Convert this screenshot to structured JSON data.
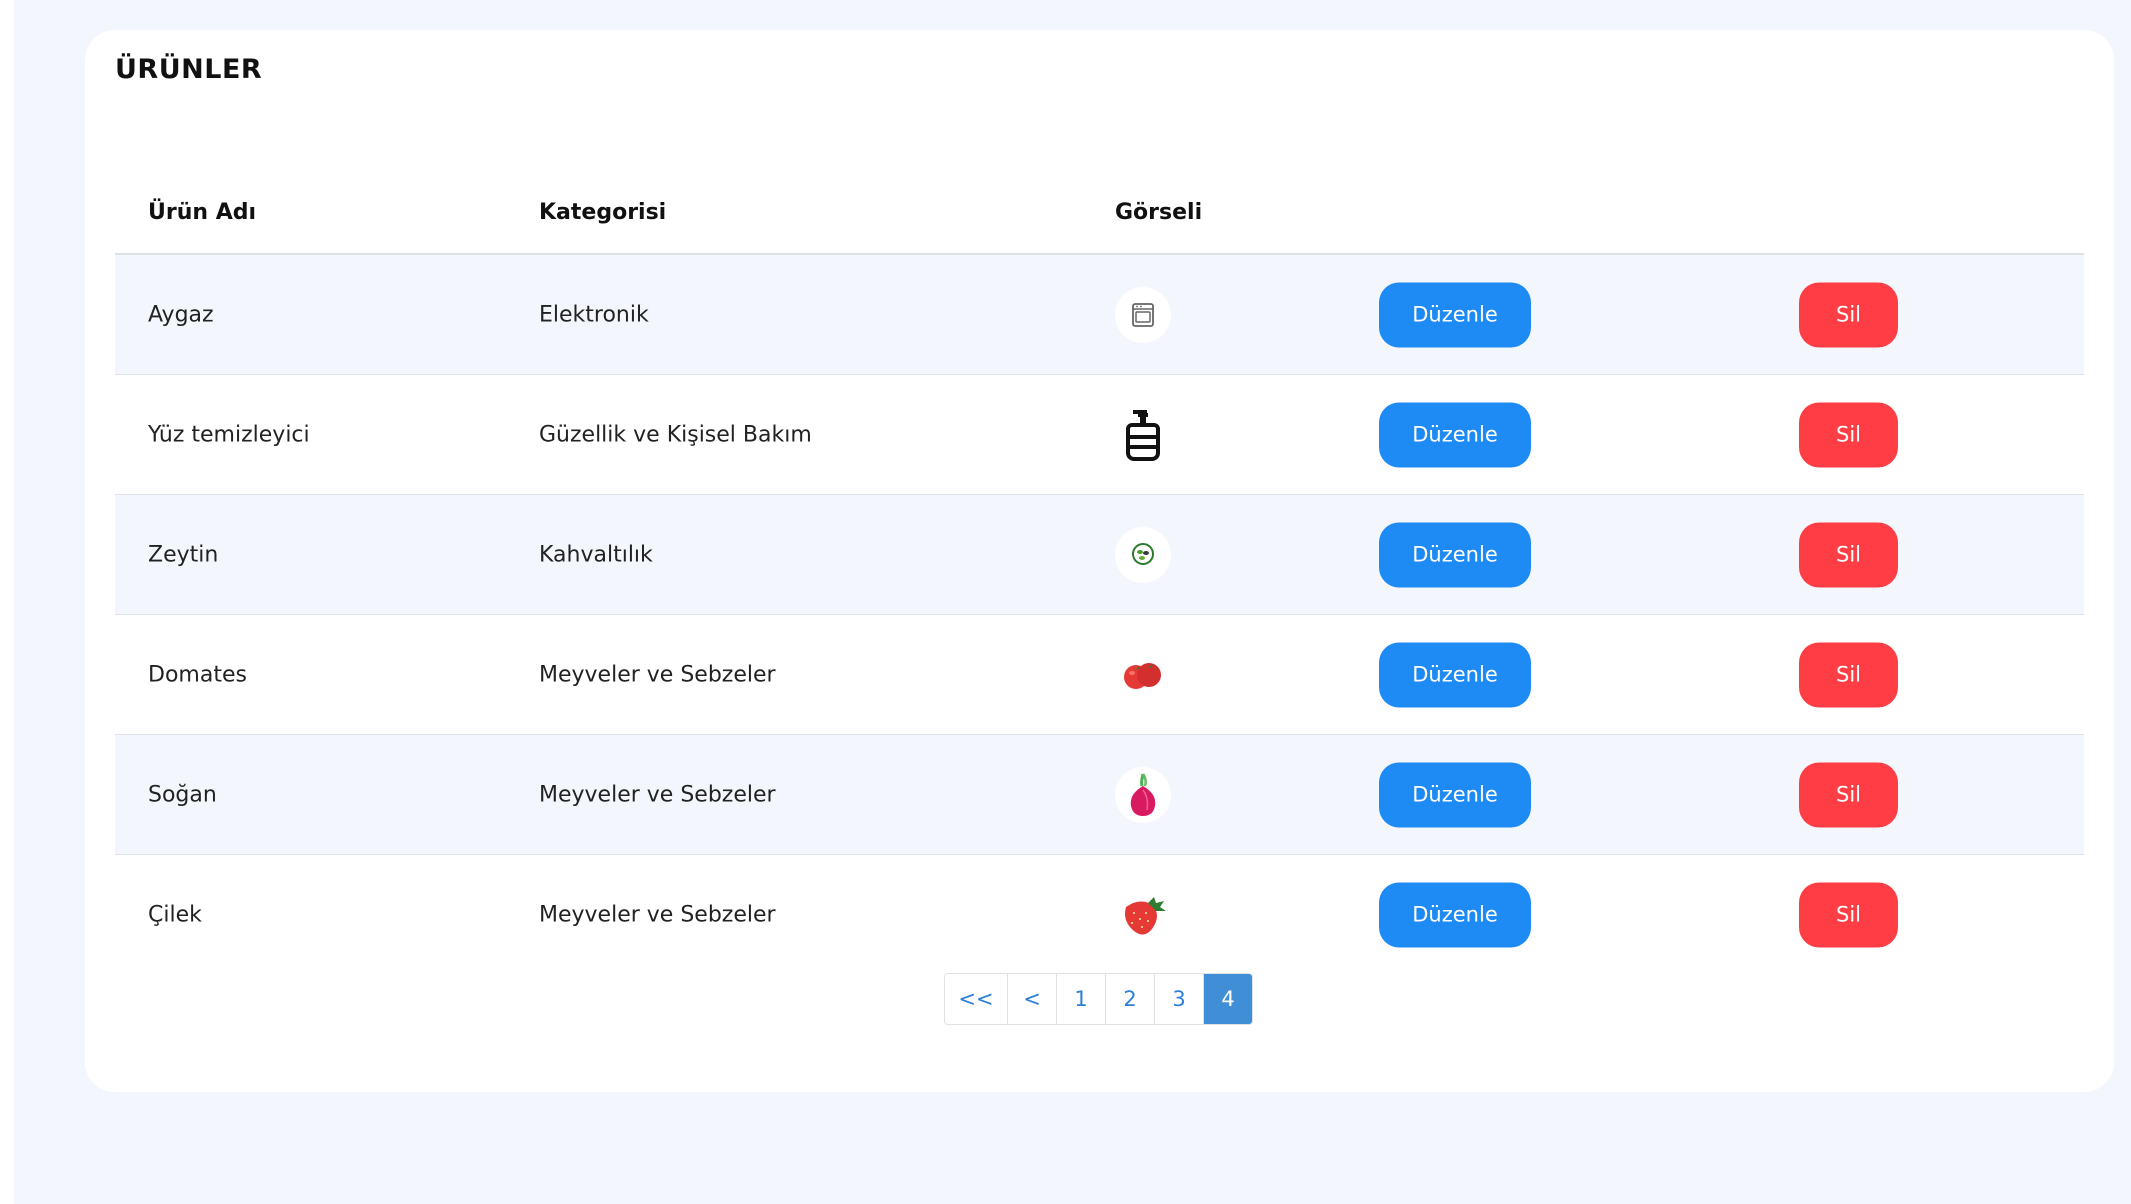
{
  "page": {
    "title": "ÜRÜNLER"
  },
  "table": {
    "headers": {
      "name": "Ürün Adı",
      "category": "Kategorisi",
      "image": "Görseli"
    },
    "rows": [
      {
        "name": "Aygaz",
        "category": "Elektronik",
        "icon": "oven-icon",
        "edit_label": "Düzenle",
        "delete_label": "Sil"
      },
      {
        "name": "Yüz temizleyici",
        "category": "Güzellik ve Kişisel Bakım",
        "icon": "soap-dispenser-icon",
        "edit_label": "Düzenle",
        "delete_label": "Sil"
      },
      {
        "name": "Zeytin",
        "category": "Kahvaltılık",
        "icon": "olive-icon",
        "edit_label": "Düzenle",
        "delete_label": "Sil"
      },
      {
        "name": "Domates",
        "category": "Meyveler ve Sebzeler",
        "icon": "tomato-icon",
        "edit_label": "Düzenle",
        "delete_label": "Sil"
      },
      {
        "name": "Soğan",
        "category": "Meyveler ve Sebzeler",
        "icon": "onion-icon",
        "edit_label": "Düzenle",
        "delete_label": "Sil"
      },
      {
        "name": "Çilek",
        "category": "Meyveler ve Sebzeler",
        "icon": "strawberry-icon",
        "edit_label": "Düzenle",
        "delete_label": "Sil"
      }
    ]
  },
  "pagination": {
    "first": "<<",
    "prev": "<",
    "pages": [
      "1",
      "2",
      "3",
      "4"
    ],
    "current": "4"
  },
  "colors": {
    "edit": "#1e8af4",
    "delete": "#ff3d45",
    "active_page": "#3f8ed6",
    "background": "#f3f6fc"
  }
}
